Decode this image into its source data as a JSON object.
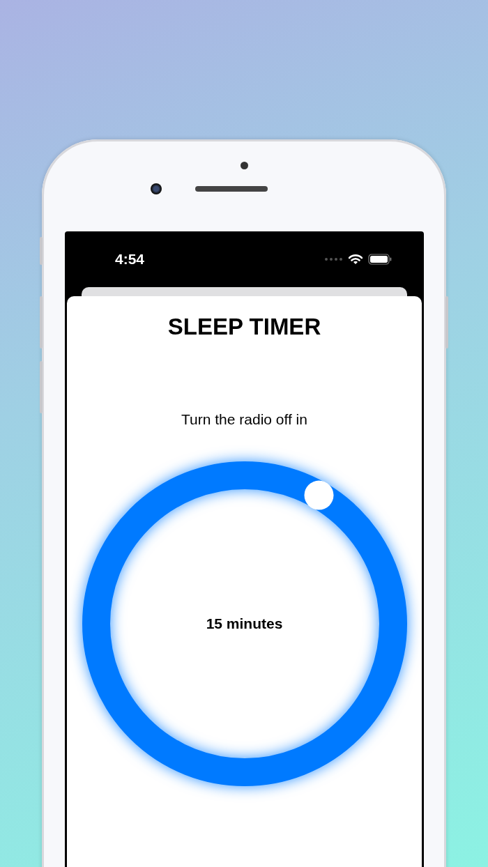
{
  "status_bar": {
    "time": "4:54"
  },
  "title": "SLEEP TIMER",
  "prompt": "Turn the radio off in",
  "timer": {
    "reading": "15 minutes"
  }
}
